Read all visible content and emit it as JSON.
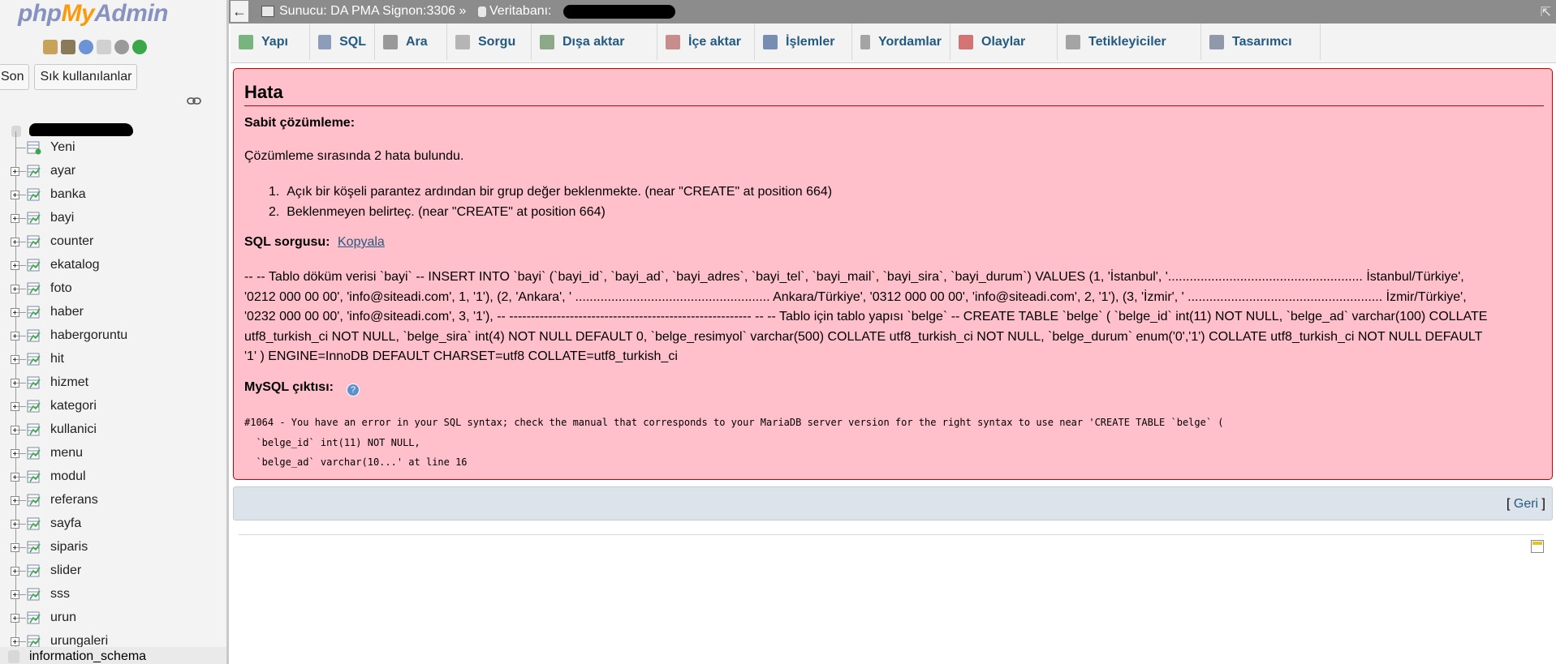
{
  "sidebar": {
    "logo": {
      "php": "php",
      "my": "My",
      "admin": "Admin"
    },
    "quick_icons": [
      "home-icon",
      "exit-icon",
      "help-icon",
      "docs-icon",
      "settings-icon",
      "reload-icon"
    ],
    "recent_label": "Son",
    "favorites_label": "Sık kullanılanlar",
    "new_label": "Yeni",
    "tables": [
      "ayar",
      "banka",
      "bayi",
      "counter",
      "ekatalog",
      "foto",
      "haber",
      "habergoruntu",
      "hit",
      "hizmet",
      "kategori",
      "kullanici",
      "menu",
      "modul",
      "referans",
      "sayfa",
      "siparis",
      "slider",
      "sss",
      "urun",
      "urungaleri"
    ],
    "other_db": "information_schema"
  },
  "topbar": {
    "back_arrow": "←",
    "server_label": "Sunucu: DA PMA Signon:3306 »",
    "database_label": "Veritabanı:",
    "collapse": "⇱"
  },
  "tabs": [
    {
      "label": "Yapı",
      "icon": "structure-icon"
    },
    {
      "label": "SQL",
      "icon": "sql-icon"
    },
    {
      "label": "Ara",
      "icon": "search-icon"
    },
    {
      "label": "Sorgu",
      "icon": "query-icon"
    },
    {
      "label": "Dışa aktar",
      "icon": "export-icon"
    },
    {
      "label": "İçe aktar",
      "icon": "import-icon"
    },
    {
      "label": "İşlemler",
      "icon": "wrench-icon"
    },
    {
      "label": "Yordamlar",
      "icon": "routines-icon"
    },
    {
      "label": "Olaylar",
      "icon": "clock-icon"
    },
    {
      "label": "Tetikleyiciler",
      "icon": "triggers-icon"
    },
    {
      "label": "Tasarımcı",
      "icon": "designer-icon"
    }
  ],
  "error": {
    "title": "Hata",
    "static_analysis": "Sabit çözümleme:",
    "found": "Çözümleme sırasında 2 hata bulundu.",
    "errors": [
      "Açık bir köşeli parantez ardından bir grup değer beklenmekte. (near \"CREATE\" at position 664)",
      "Beklenmeyen belirteç. (near \"CREATE\" at position 664)"
    ],
    "sql_label": "SQL sorgusu:",
    "copy_link": "Kopyala",
    "sql_lines": [
      "-- -- Tablo döküm verisi `bayi` -- INSERT INTO `bayi` (`bayi_id`, `bayi_ad`, `bayi_adres`, `bayi_tel`, `bayi_mail`, `bayi_sira`, `bayi_durum`) VALUES (1, 'İstanbul', '...................................................... İstanbul/Türkiye',",
      "'0212 000 00 00', 'info@siteadi.com', 1, '1'), (2, 'Ankara', ' ...................................................... Ankara/Türkiye', '0312 000 00 00', 'info@siteadi.com', 2, '1'), (3, 'İzmir', ' ...................................................... İzmir/Türkiye',",
      "'0232 000 00 00', 'info@siteadi.com', 3, '1'), -- -------------------------------------------------------- -- -- Tablo için tablo yapısı `belge` -- CREATE TABLE `belge` ( `belge_id` int(11) NOT NULL, `belge_ad` varchar(100) COLLATE",
      "utf8_turkish_ci NOT NULL, `belge_sira` int(4) NOT NULL DEFAULT 0, `belge_resimyol` varchar(500) COLLATE utf8_turkish_ci NOT NULL, `belge_durum` enum('0','1') COLLATE utf8_turkish_ci NOT NULL DEFAULT",
      "'1' ) ENGINE=InnoDB DEFAULT CHARSET=utf8 COLLATE=utf8_turkish_ci"
    ],
    "mysql_label": "MySQL çıktısı:",
    "mysql_help": "?",
    "mysql_output": [
      "#1064 - You have an error in your SQL syntax; check the manual that corresponds to your MariaDB server version for the right syntax to use near 'CREATE TABLE `belge` (",
      "  `belge_id` int(11) NOT NULL,",
      "  `belge_ad` varchar(10...' at line 16"
    ]
  },
  "back": {
    "open": "[ ",
    "label": "Geri",
    "close": " ]"
  },
  "colors": {
    "error_bg": "#ffc0cb",
    "error_border": "#cc0000",
    "link": "#235a81",
    "topbar": "#8c8c8c"
  }
}
